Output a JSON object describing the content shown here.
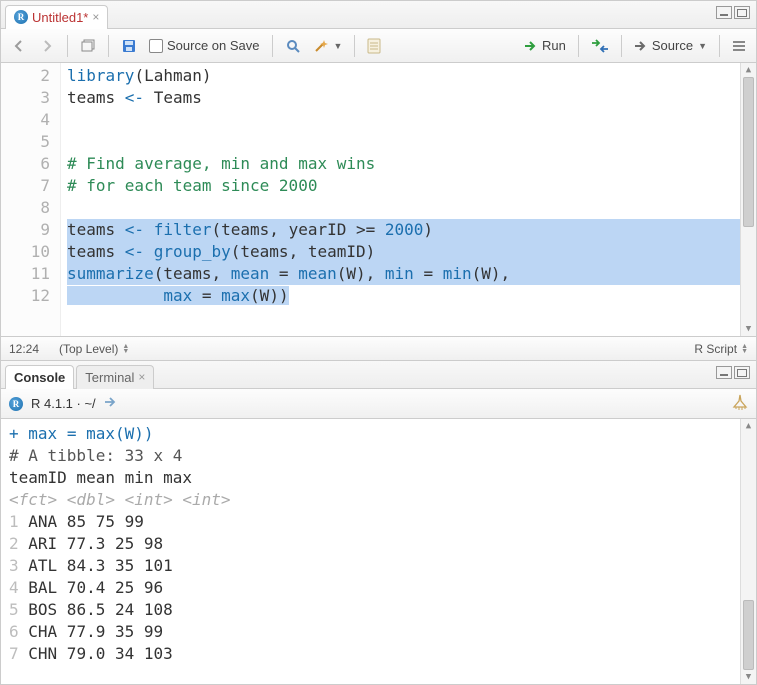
{
  "source": {
    "tab_title": "Untitled1*",
    "toolbar": {
      "source_on_save_label": "Source on Save",
      "run_label": "Run",
      "source_label": "Source"
    },
    "status": {
      "cursor": "12:24",
      "scope": "(Top Level)",
      "lang": "R Script"
    },
    "lines": [
      {
        "n": 2,
        "type": "code",
        "raw": "library(Lahman)"
      },
      {
        "n": 3,
        "type": "code",
        "raw": "teams <- Teams"
      },
      {
        "n": 4,
        "type": "blank",
        "raw": ""
      },
      {
        "n": 5,
        "type": "blank",
        "raw": ""
      },
      {
        "n": 6,
        "type": "comment",
        "raw": "# Find average, min and max wins"
      },
      {
        "n": 7,
        "type": "comment",
        "raw": "# for each team since 2000"
      },
      {
        "n": 8,
        "type": "blank",
        "raw": "",
        "sel": true
      },
      {
        "n": 9,
        "type": "code",
        "raw": "teams <- filter(teams, yearID >= 2000)",
        "sel": true
      },
      {
        "n": 10,
        "type": "code",
        "raw": "teams <- group_by(teams, teamID)",
        "sel": true
      },
      {
        "n": 11,
        "type": "code",
        "raw": "summarize(teams, mean = mean(W), min = min(W),",
        "sel": true
      },
      {
        "n": 12,
        "type": "code",
        "raw": "          max = max(W))",
        "sel": "partial"
      }
    ]
  },
  "console": {
    "tabs": {
      "console": "Console",
      "terminal": "Terminal"
    },
    "prompt": "R 4.1.1 · ~/",
    "cont_line": "          max = max(W))",
    "tibble_head": "# A tibble: 33 x 4",
    "col_header": "  teamID  mean   min   max",
    "col_types": "  <fct>  <dbl> <int> <int>",
    "rows": [
      {
        "i": 1,
        "team": "ANA",
        "mean": "85",
        "min": "75",
        "max": "99"
      },
      {
        "i": 2,
        "team": "ARI",
        "mean": "77.3",
        "min": "25",
        "max": "98"
      },
      {
        "i": 3,
        "team": "ATL",
        "mean": "84.3",
        "min": "35",
        "max": "101"
      },
      {
        "i": 4,
        "team": "BAL",
        "mean": "70.4",
        "min": "25",
        "max": "96"
      },
      {
        "i": 5,
        "team": "BOS",
        "mean": "86.5",
        "min": "24",
        "max": "108"
      },
      {
        "i": 6,
        "team": "CHA",
        "mean": "77.9",
        "min": "35",
        "max": "99"
      },
      {
        "i": 7,
        "team": "CHN",
        "mean": "79.0",
        "min": "34",
        "max": "103"
      }
    ]
  }
}
